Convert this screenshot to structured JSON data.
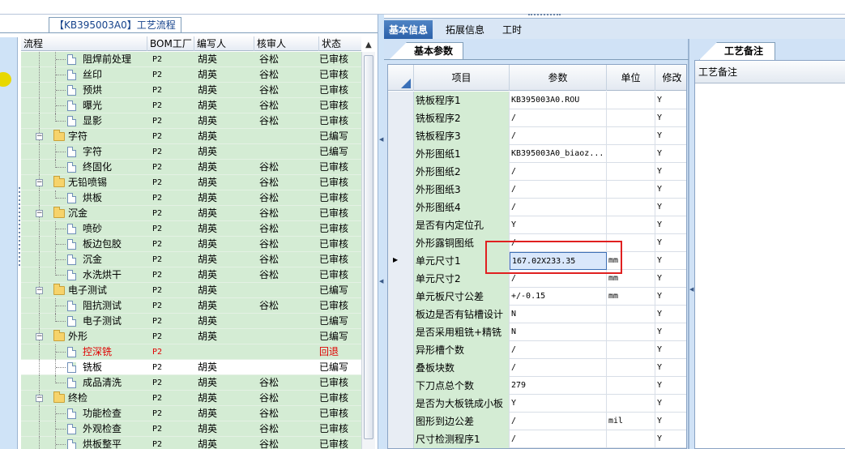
{
  "left_panel": {
    "tab_label": "【KB395003A0】工艺流程",
    "columns": [
      "流程",
      "BOM工厂",
      "编写人",
      "核审人",
      "状态"
    ],
    "rows": [
      {
        "name": "阻焊前处理",
        "bom": "P2",
        "writer": "胡英",
        "reviewer": "谷松",
        "status": "已审核",
        "type": "leaf"
      },
      {
        "name": "丝印",
        "bom": "P2",
        "writer": "胡英",
        "reviewer": "谷松",
        "status": "已审核",
        "type": "leaf"
      },
      {
        "name": "预烘",
        "bom": "P2",
        "writer": "胡英",
        "reviewer": "谷松",
        "status": "已审核",
        "type": "leaf"
      },
      {
        "name": "曝光",
        "bom": "P2",
        "writer": "胡英",
        "reviewer": "谷松",
        "status": "已审核",
        "type": "leaf"
      },
      {
        "name": "显影",
        "bom": "P2",
        "writer": "胡英",
        "reviewer": "谷松",
        "status": "已审核",
        "type": "leaf-last"
      },
      {
        "name": "字符",
        "bom": "P2",
        "writer": "胡英",
        "reviewer": "",
        "status": "已编写",
        "type": "folder"
      },
      {
        "name": "字符",
        "bom": "P2",
        "writer": "胡英",
        "reviewer": "",
        "status": "已编写",
        "type": "leaf"
      },
      {
        "name": "终固化",
        "bom": "P2",
        "writer": "胡英",
        "reviewer": "谷松",
        "status": "已审核",
        "type": "leaf-last"
      },
      {
        "name": "无铅喷锡",
        "bom": "P2",
        "writer": "胡英",
        "reviewer": "谷松",
        "status": "已审核",
        "type": "folder"
      },
      {
        "name": "烘板",
        "bom": "P2",
        "writer": "胡英",
        "reviewer": "谷松",
        "status": "已审核",
        "type": "leaf-last"
      },
      {
        "name": "沉金",
        "bom": "P2",
        "writer": "胡英",
        "reviewer": "谷松",
        "status": "已审核",
        "type": "folder"
      },
      {
        "name": "喷砂",
        "bom": "P2",
        "writer": "胡英",
        "reviewer": "谷松",
        "status": "已审核",
        "type": "leaf"
      },
      {
        "name": "板边包胶",
        "bom": "P2",
        "writer": "胡英",
        "reviewer": "谷松",
        "status": "已审核",
        "type": "leaf"
      },
      {
        "name": "沉金",
        "bom": "P2",
        "writer": "胡英",
        "reviewer": "谷松",
        "status": "已审核",
        "type": "leaf"
      },
      {
        "name": "水洗烘干",
        "bom": "P2",
        "writer": "胡英",
        "reviewer": "谷松",
        "status": "已审核",
        "type": "leaf-last"
      },
      {
        "name": "电子测试",
        "bom": "P2",
        "writer": "胡英",
        "reviewer": "",
        "status": "已编写",
        "type": "folder"
      },
      {
        "name": "阻抗测试",
        "bom": "P2",
        "writer": "胡英",
        "reviewer": "谷松",
        "status": "已审核",
        "type": "leaf"
      },
      {
        "name": "电子测试",
        "bom": "P2",
        "writer": "胡英",
        "reviewer": "",
        "status": "已编写",
        "type": "leaf-last"
      },
      {
        "name": "外形",
        "bom": "P2",
        "writer": "胡英",
        "reviewer": "",
        "status": "已编写",
        "type": "folder"
      },
      {
        "name": "控深铣",
        "bom": "P2",
        "writer": "",
        "reviewer": "",
        "status": "回退",
        "type": "leaf",
        "red": true
      },
      {
        "name": "铣板",
        "bom": "P2",
        "writer": "胡英",
        "reviewer": "",
        "status": "已编写",
        "type": "leaf",
        "selected": true
      },
      {
        "name": "成品清洗",
        "bom": "P2",
        "writer": "胡英",
        "reviewer": "谷松",
        "status": "已审核",
        "type": "leaf-last"
      },
      {
        "name": "终检",
        "bom": "P2",
        "writer": "胡英",
        "reviewer": "谷松",
        "status": "已审核",
        "type": "folder"
      },
      {
        "name": "功能检查",
        "bom": "P2",
        "writer": "胡英",
        "reviewer": "谷松",
        "status": "已审核",
        "type": "leaf"
      },
      {
        "name": "外观检查",
        "bom": "P2",
        "writer": "胡英",
        "reviewer": "谷松",
        "status": "已审核",
        "type": "leaf"
      },
      {
        "name": "烘板整平",
        "bom": "P2",
        "writer": "胡英",
        "reviewer": "谷松",
        "status": "已审核",
        "type": "leaf"
      }
    ]
  },
  "top_tabs": [
    "基本信息",
    "拓展信息",
    "工时"
  ],
  "base_params": {
    "tab_label": "基本参数",
    "columns": [
      "项目",
      "参数",
      "单位",
      "修改"
    ],
    "rows": [
      {
        "item": "铣板程序1",
        "param": "KB395003A0.ROU",
        "unit": "",
        "mod": "Y"
      },
      {
        "item": "铣板程序2",
        "param": "/",
        "unit": "",
        "mod": "Y"
      },
      {
        "item": "铣板程序3",
        "param": "/",
        "unit": "",
        "mod": "Y"
      },
      {
        "item": "外形图纸1",
        "param": "KB395003A0_biaoz...",
        "unit": "",
        "mod": "Y"
      },
      {
        "item": "外形图纸2",
        "param": "/",
        "unit": "",
        "mod": "Y"
      },
      {
        "item": "外形图纸3",
        "param": "/",
        "unit": "",
        "mod": "Y"
      },
      {
        "item": "外形图纸4",
        "param": "/",
        "unit": "",
        "mod": "Y"
      },
      {
        "item": "是否有内定位孔",
        "param": "Y",
        "unit": "",
        "mod": "Y"
      },
      {
        "item": "外形露铜图纸",
        "param": "/",
        "unit": "",
        "mod": "Y"
      },
      {
        "item": "单元尺寸1",
        "param": "167.02X233.35",
        "unit": "mm",
        "mod": "Y",
        "current": true
      },
      {
        "item": "单元尺寸2",
        "param": "/",
        "unit": "mm",
        "mod": "Y"
      },
      {
        "item": "单元板尺寸公差",
        "param": "+/-0.15",
        "unit": "mm",
        "mod": "Y"
      },
      {
        "item": "板边是否有钻槽设计",
        "param": "N",
        "unit": "",
        "mod": "Y"
      },
      {
        "item": "是否采用粗铣+精铣",
        "param": "N",
        "unit": "",
        "mod": "Y"
      },
      {
        "item": "异形槽个数",
        "param": "/",
        "unit": "",
        "mod": "Y"
      },
      {
        "item": "叠板块数",
        "param": "/",
        "unit": "",
        "mod": "Y"
      },
      {
        "item": "下刀点总个数",
        "param": "279",
        "unit": "",
        "mod": "Y"
      },
      {
        "item": "是否为大板铣成小板",
        "param": "Y",
        "unit": "",
        "mod": "Y"
      },
      {
        "item": "图形到边公差",
        "param": "/",
        "unit": "mil",
        "mod": "Y"
      },
      {
        "item": "尺寸检测程序1",
        "param": "/",
        "unit": "",
        "mod": "Y"
      }
    ]
  },
  "notes": {
    "tab_label": "工艺备注",
    "column": "工艺备注"
  }
}
